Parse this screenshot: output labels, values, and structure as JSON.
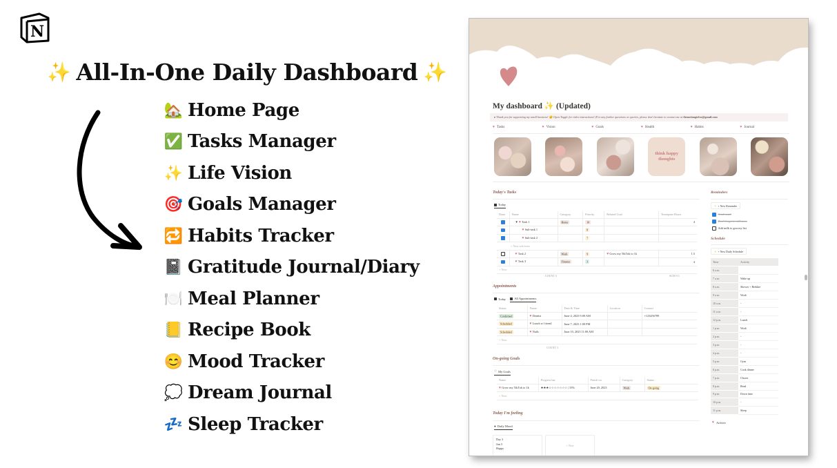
{
  "promo": {
    "logo_letter": "N",
    "logo_icon": "notion-logo-icon",
    "headline": "All-In-One Daily Dashboard",
    "headline_left_icon": "✨",
    "headline_right_icon": "✨",
    "features": [
      {
        "icon": "🏡",
        "icon_name": "house-garden-icon",
        "label": "Home Page"
      },
      {
        "icon": "✅",
        "icon_name": "check-mark-button-icon",
        "label": "Tasks Manager"
      },
      {
        "icon": "✨",
        "icon_name": "sparkles-icon",
        "label": "Life Vision"
      },
      {
        "icon": "🎯",
        "icon_name": "bullseye-icon",
        "label": "Goals Manager"
      },
      {
        "icon": "🔁",
        "icon_name": "repeat-icon",
        "label": "Habits Tracker"
      },
      {
        "icon": "📓",
        "icon_name": "notebook-icon",
        "label": "Gratitude Journal/Diary"
      },
      {
        "icon": "🍽️",
        "icon_name": "plate-cutlery-icon",
        "label": "Meal Planner"
      },
      {
        "icon": "📒",
        "icon_name": "ledger-icon",
        "label": "Recipe Book"
      },
      {
        "icon": "😊",
        "icon_name": "smiling-face-icon",
        "label": "Mood Tracker"
      },
      {
        "icon": "💭",
        "icon_name": "thought-bubble-icon",
        "label": "Dream Journal"
      },
      {
        "icon": "💤",
        "icon_name": "zzz-icon",
        "label": "Sleep Tracker"
      }
    ]
  },
  "dashboard": {
    "title": "My dashboard ✨ (Updated)",
    "callout_text": "Thank you for supporting my small business! 😊 Open Toggle for video instructions! (For any further questions or queries, please don't hesitate to contact me at ",
    "callout_email": "thenotiongirlco@gmail.com",
    "nav": [
      "Tasks",
      "Vision",
      "Goals",
      "Health",
      "Habits",
      "Journal"
    ],
    "gallery_quote": "think happy thoughts",
    "colors": {
      "cover": "#e9dccd",
      "heart": "#d48a8a",
      "accent_text": "#8b5e52",
      "checkbox": "#2e7fd6"
    },
    "tasks": {
      "section_title": "Today's Tasks",
      "view_tab": "Today",
      "columns": [
        "Done",
        "Name",
        "Category",
        "Priority",
        "Related Goal",
        "Timespent Hours"
      ],
      "rows": [
        {
          "done": true,
          "name": "Task 1",
          "category": "Home",
          "priority": "10",
          "goal": "",
          "hours": "4",
          "toggle": "▼"
        },
        {
          "done": true,
          "name": "Sub-task 1",
          "category": "",
          "priority": "8",
          "goal": "",
          "hours": "",
          "sub": true
        },
        {
          "done": true,
          "name": "Sub-task 2",
          "category": "",
          "priority": "7",
          "goal": "",
          "hours": "",
          "sub": true
        },
        {
          "done": false,
          "name": "Task 2",
          "category": "Work",
          "priority": "9",
          "goal": "Grow my TikTok to 1k",
          "hours": "1.5"
        },
        {
          "done": true,
          "name": "Task 3",
          "category": "Finance",
          "priority": "3",
          "goal": "",
          "hours": "4"
        }
      ],
      "new_sub_items": "+ New sub-item",
      "new_row": "+ New",
      "footer_count": "COUNT 3",
      "footer_sum": "SUM 9.5"
    },
    "appointments": {
      "section_title": "Appointments",
      "tabs": [
        "Today",
        "All Appointments"
      ],
      "columns": [
        "Status",
        "Name",
        "Date & Time",
        "Location",
        "Contact"
      ],
      "rows": [
        {
          "status": "Confirmed",
          "name": "Dentist",
          "datetime": "June 4, 2023 9:00 AM",
          "location": "",
          "contact": "+123456789"
        },
        {
          "status": "Scheduled",
          "name": "Lunch w/ friend",
          "datetime": "June 7, 2023 1:00 PM",
          "location": "",
          "contact": ""
        },
        {
          "status": "Scheduled",
          "name": "Nails",
          "datetime": "June 10, 2023 11:00 AM",
          "location": "",
          "contact": ""
        }
      ],
      "new_row": "+ New",
      "footer_count": "COUNT 3"
    },
    "goals": {
      "section_title": "On-going Goals",
      "view_tab": "My Goals",
      "columns": [
        "Name",
        "Progress bar",
        "Finish on",
        "Category",
        "Status"
      ],
      "rows": [
        {
          "name": "Grow my TikTok to 1k",
          "progress_stars": "★★★☆☆☆☆☆☆☆",
          "progress_percent": "33%",
          "finish_on": "June 20, 2023",
          "category": "Work",
          "status": "On-going"
        }
      ],
      "new_row": "+ New"
    },
    "mood": {
      "section_title": "Today I'm feeling",
      "view_tab": "Daily Mood",
      "card_day": "Day 3",
      "card_value": "Jun 3",
      "card_mood": "Happy",
      "new_card": "+ New"
    },
    "reminders": {
      "section_title": "Reminders",
      "new_button": "+ New Reminder",
      "items": [
        {
          "done": true,
          "text": "Send email"
        },
        {
          "done": true,
          "text": "Don't forget to call mom"
        },
        {
          "done": false,
          "text": "Add milk to grocery list"
        }
      ]
    },
    "schedule": {
      "section_title": "Schedule",
      "new_button": "+ New Daily Schedule",
      "columns": [
        "Time",
        "Activity"
      ],
      "rows": [
        {
          "time": "6 a.m.",
          "activity": ""
        },
        {
          "time": "7 a.m.",
          "activity": "Wake up"
        },
        {
          "time": "8 a.m.",
          "activity": "Shower + Brekkie"
        },
        {
          "time": "9 a.m.",
          "activity": "Work"
        },
        {
          "time": "10 a.m.",
          "activity": "-"
        },
        {
          "time": "11 a.m.",
          "activity": "-"
        },
        {
          "time": "12 p.m.",
          "activity": "Lunch"
        },
        {
          "time": "1 p.m.",
          "activity": "Work"
        },
        {
          "time": "2 p.m.",
          "activity": "-"
        },
        {
          "time": "3 p.m.",
          "activity": "-"
        },
        {
          "time": "4 p.m.",
          "activity": "-"
        },
        {
          "time": "5 p.m.",
          "activity": "Gym"
        },
        {
          "time": "6 p.m.",
          "activity": "Cook dinner"
        },
        {
          "time": "7 p.m.",
          "activity": "Chores"
        },
        {
          "time": "8 p.m.",
          "activity": "Read"
        },
        {
          "time": "9 p.m.",
          "activity": "Down time"
        },
        {
          "time": "10 p.m.",
          "activity": "-"
        },
        {
          "time": "11 p.m.",
          "activity": "Sleep"
        }
      ],
      "archive_label": "Archive"
    }
  }
}
